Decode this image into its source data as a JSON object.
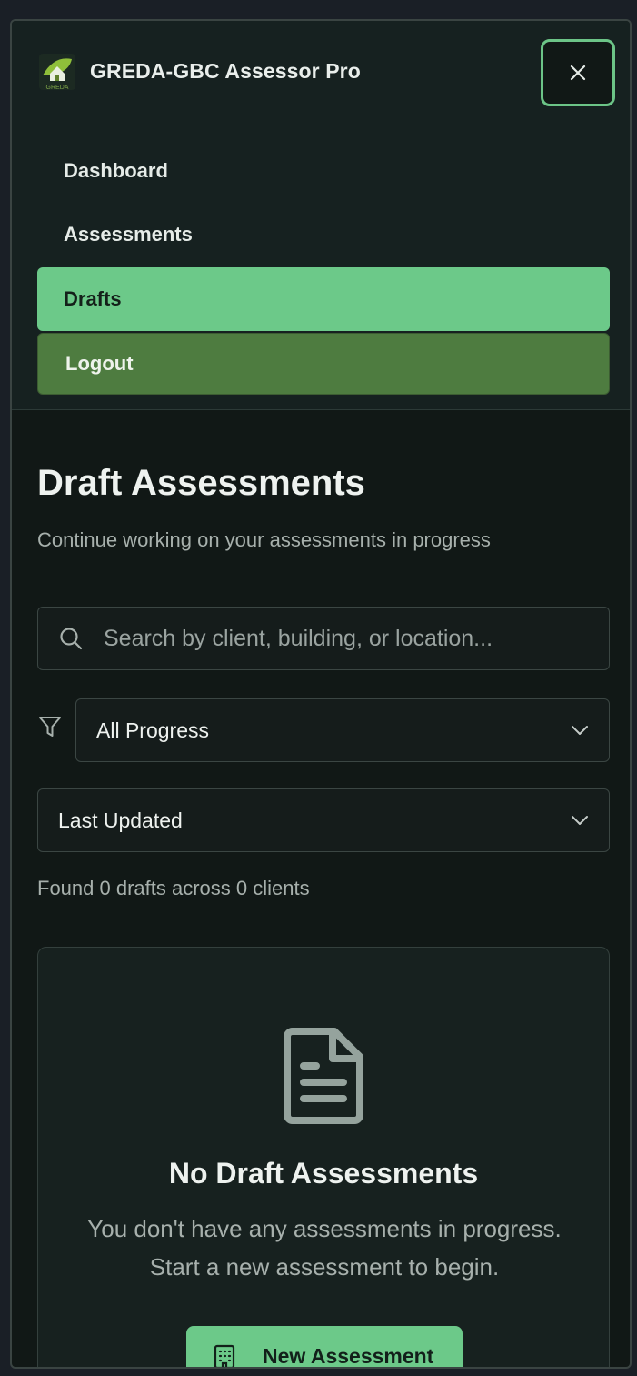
{
  "app": {
    "title": "GREDA-GBC Assessor Pro",
    "logo_text": "GREDA"
  },
  "nav": {
    "items": [
      {
        "label": "Dashboard"
      },
      {
        "label": "Assessments"
      },
      {
        "label": "Drafts"
      },
      {
        "label": "Logout"
      }
    ]
  },
  "page": {
    "title": "Draft Assessments",
    "subtitle": "Continue working on your assessments in progress"
  },
  "search": {
    "placeholder": "Search by client, building, or location..."
  },
  "filters": {
    "progress": "All Progress",
    "sort": "Last Updated"
  },
  "results": {
    "summary": "Found 0 drafts across 0 clients"
  },
  "empty_state": {
    "title": "No Draft Assessments",
    "text": "You don't have any assessments in progress. Start a new assessment to begin.",
    "button_label": "New Assessment"
  },
  "colors": {
    "accent": "#6cc989",
    "logout": "#4e7c40",
    "background": "#111816"
  },
  "icons": [
    "greda-logo",
    "close-icon",
    "search-icon",
    "filter-icon",
    "chevron-down-icon",
    "document-icon",
    "building-icon"
  ]
}
